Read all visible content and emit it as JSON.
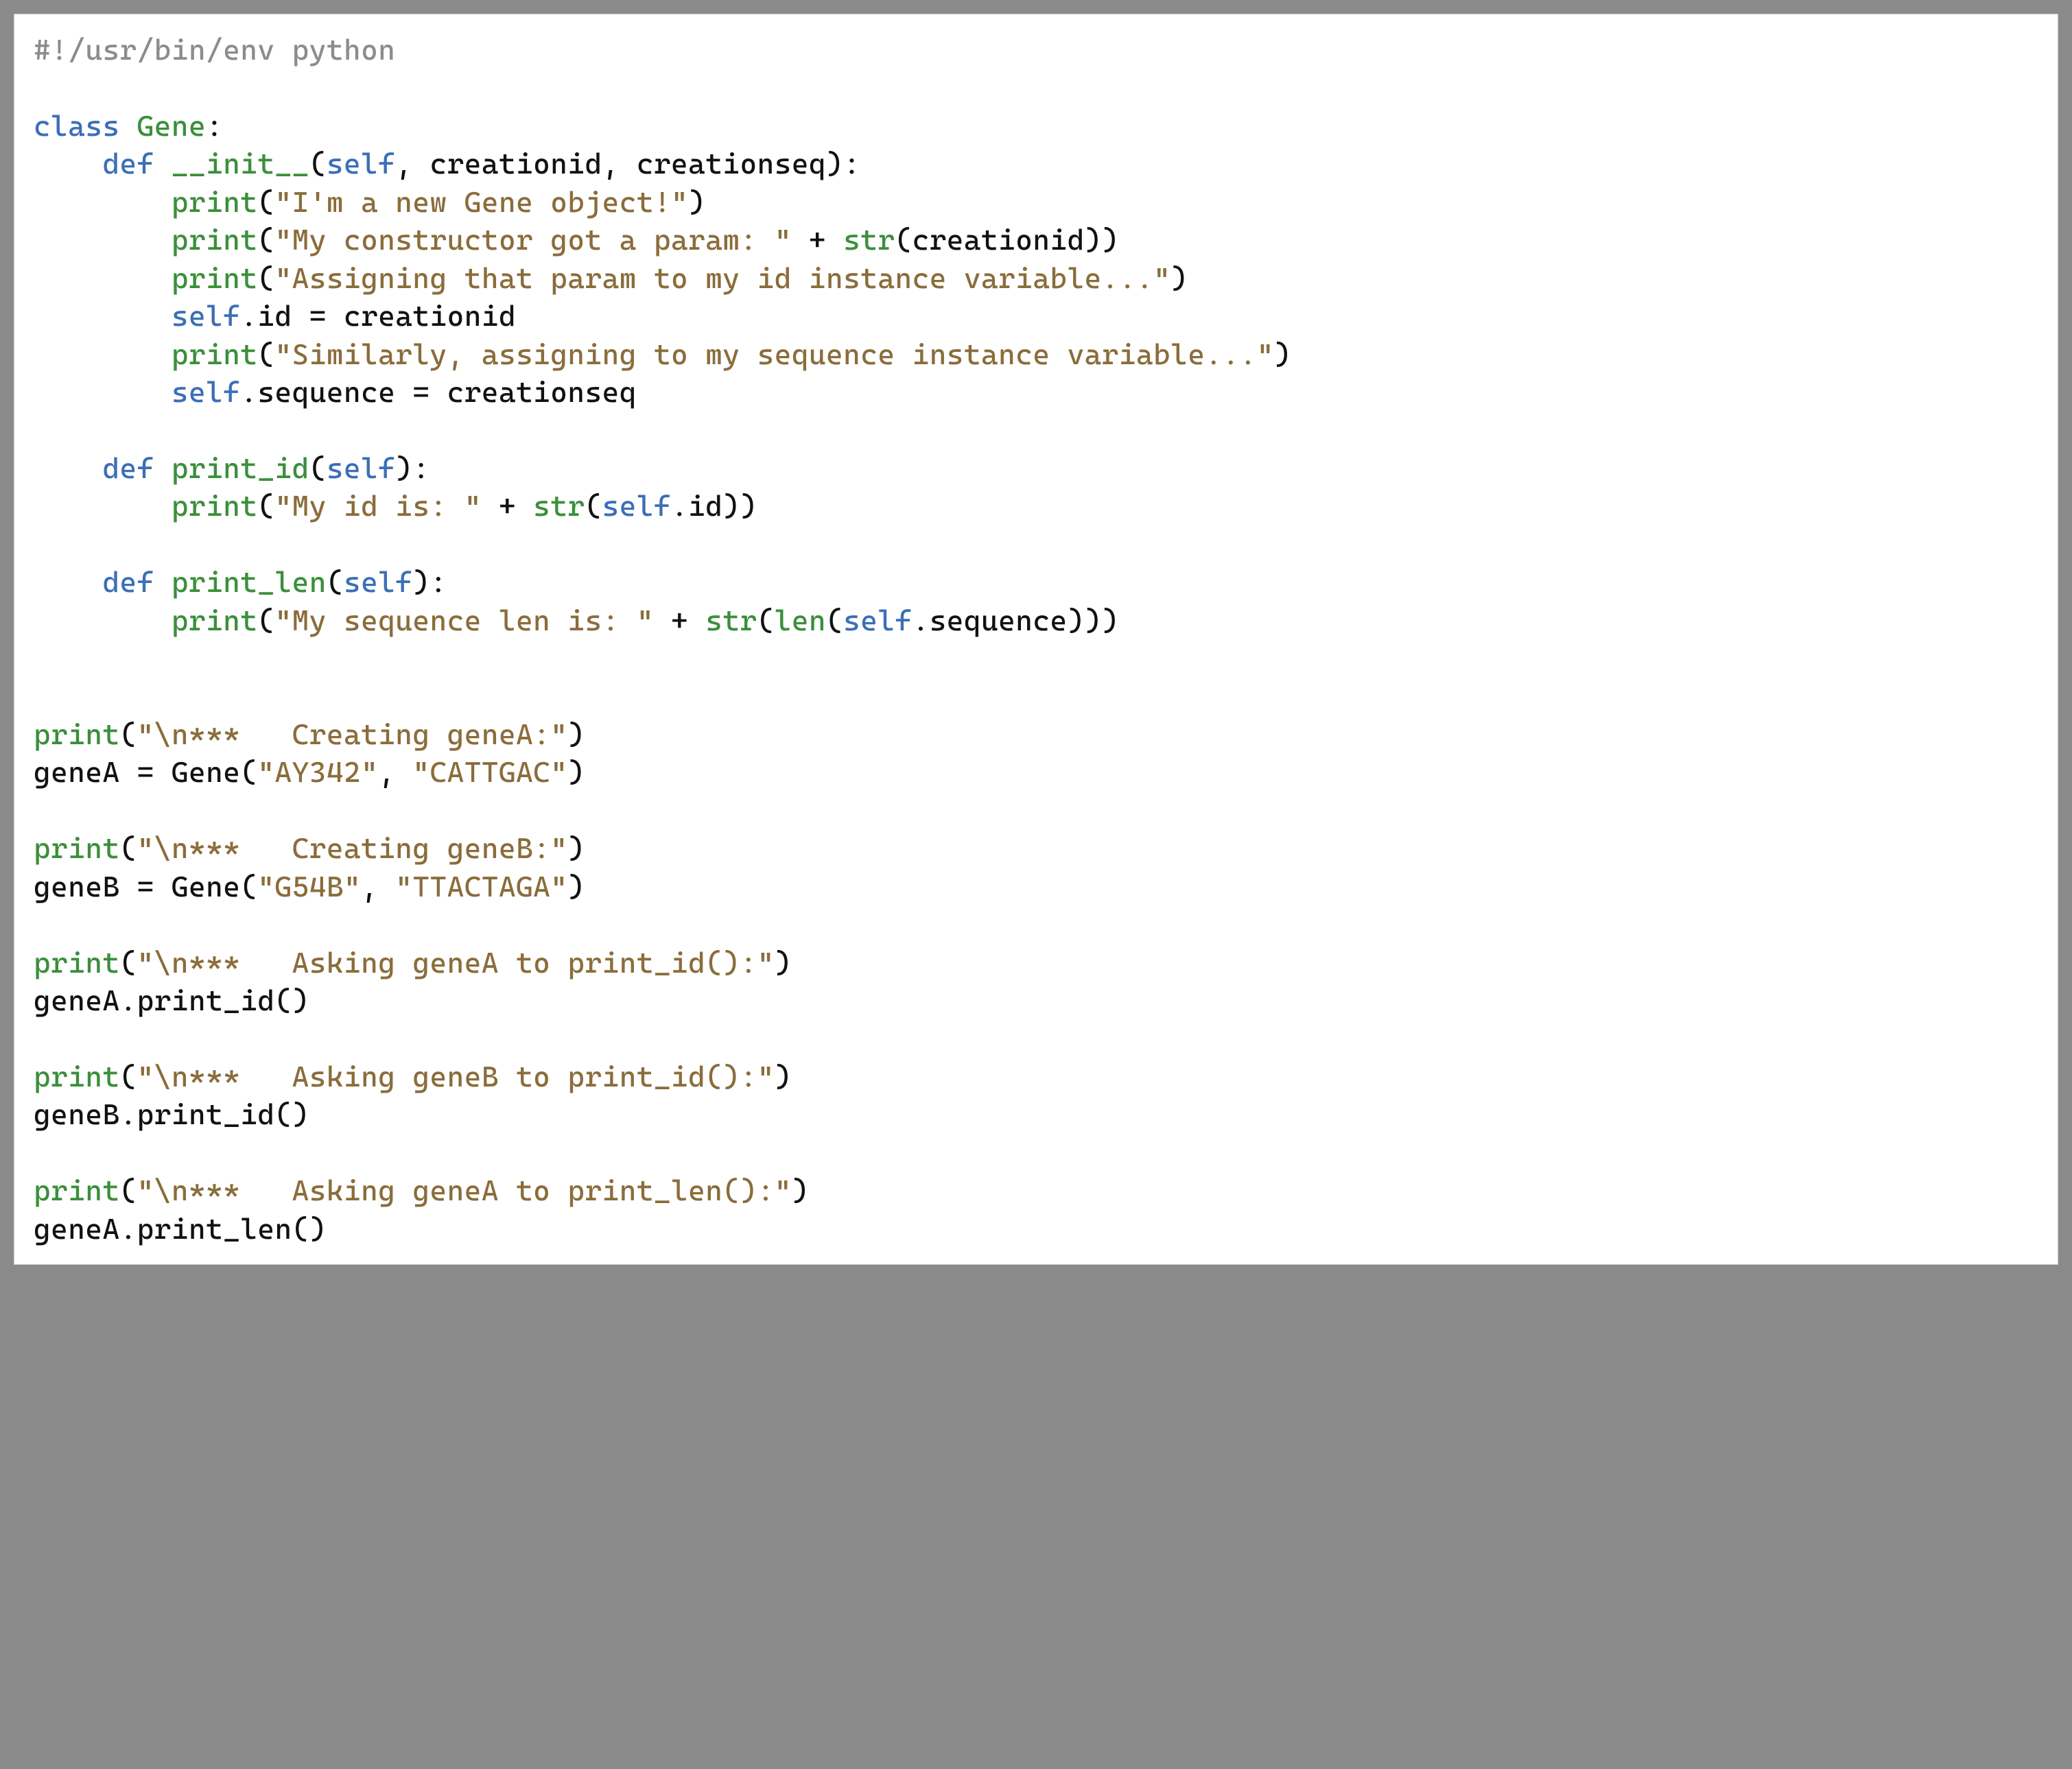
{
  "code": {
    "lines": [
      [
        {
          "cls": "c-comment",
          "text": "#!/usr/bin/env python"
        }
      ],
      [],
      [
        {
          "cls": "c-keyword",
          "text": "class"
        },
        {
          "cls": "c-plain",
          "text": " "
        },
        {
          "cls": "c-classname",
          "text": "Gene"
        },
        {
          "cls": "c-plain",
          "text": ":"
        }
      ],
      [
        {
          "cls": "c-plain",
          "text": "    "
        },
        {
          "cls": "c-keyword",
          "text": "def"
        },
        {
          "cls": "c-plain",
          "text": " "
        },
        {
          "cls": "c-defname",
          "text": "__init__"
        },
        {
          "cls": "c-plain",
          "text": "("
        },
        {
          "cls": "c-keyword",
          "text": "self"
        },
        {
          "cls": "c-plain",
          "text": ", creationid, creationseq):"
        }
      ],
      [
        {
          "cls": "c-plain",
          "text": "        "
        },
        {
          "cls": "c-builtin",
          "text": "print"
        },
        {
          "cls": "c-plain",
          "text": "("
        },
        {
          "cls": "c-string",
          "text": "\"I'm a new Gene object!\""
        },
        {
          "cls": "c-plain",
          "text": ")"
        }
      ],
      [
        {
          "cls": "c-plain",
          "text": "        "
        },
        {
          "cls": "c-builtin",
          "text": "print"
        },
        {
          "cls": "c-plain",
          "text": "("
        },
        {
          "cls": "c-string",
          "text": "\"My constructor got a param: \""
        },
        {
          "cls": "c-plain",
          "text": " + "
        },
        {
          "cls": "c-builtin",
          "text": "str"
        },
        {
          "cls": "c-plain",
          "text": "(creationid))"
        }
      ],
      [
        {
          "cls": "c-plain",
          "text": "        "
        },
        {
          "cls": "c-builtin",
          "text": "print"
        },
        {
          "cls": "c-plain",
          "text": "("
        },
        {
          "cls": "c-string",
          "text": "\"Assigning that param to my id instance variable...\""
        },
        {
          "cls": "c-plain",
          "text": ")"
        }
      ],
      [
        {
          "cls": "c-plain",
          "text": "        "
        },
        {
          "cls": "c-keyword",
          "text": "self"
        },
        {
          "cls": "c-plain",
          "text": ".id = creationid"
        }
      ],
      [
        {
          "cls": "c-plain",
          "text": "        "
        },
        {
          "cls": "c-builtin",
          "text": "print"
        },
        {
          "cls": "c-plain",
          "text": "("
        },
        {
          "cls": "c-string",
          "text": "\"Similarly, assigning to my sequence instance variable...\""
        },
        {
          "cls": "c-plain",
          "text": ")"
        }
      ],
      [
        {
          "cls": "c-plain",
          "text": "        "
        },
        {
          "cls": "c-keyword",
          "text": "self"
        },
        {
          "cls": "c-plain",
          "text": ".sequence = creationseq"
        }
      ],
      [],
      [
        {
          "cls": "c-plain",
          "text": "    "
        },
        {
          "cls": "c-keyword",
          "text": "def"
        },
        {
          "cls": "c-plain",
          "text": " "
        },
        {
          "cls": "c-defname",
          "text": "print_id"
        },
        {
          "cls": "c-plain",
          "text": "("
        },
        {
          "cls": "c-keyword",
          "text": "self"
        },
        {
          "cls": "c-plain",
          "text": "):"
        }
      ],
      [
        {
          "cls": "c-plain",
          "text": "        "
        },
        {
          "cls": "c-builtin",
          "text": "print"
        },
        {
          "cls": "c-plain",
          "text": "("
        },
        {
          "cls": "c-string",
          "text": "\"My id is: \""
        },
        {
          "cls": "c-plain",
          "text": " + "
        },
        {
          "cls": "c-builtin",
          "text": "str"
        },
        {
          "cls": "c-plain",
          "text": "("
        },
        {
          "cls": "c-keyword",
          "text": "self"
        },
        {
          "cls": "c-plain",
          "text": ".id))"
        }
      ],
      [],
      [
        {
          "cls": "c-plain",
          "text": "    "
        },
        {
          "cls": "c-keyword",
          "text": "def"
        },
        {
          "cls": "c-plain",
          "text": " "
        },
        {
          "cls": "c-defname",
          "text": "print_len"
        },
        {
          "cls": "c-plain",
          "text": "("
        },
        {
          "cls": "c-keyword",
          "text": "self"
        },
        {
          "cls": "c-plain",
          "text": "):"
        }
      ],
      [
        {
          "cls": "c-plain",
          "text": "        "
        },
        {
          "cls": "c-builtin",
          "text": "print"
        },
        {
          "cls": "c-plain",
          "text": "("
        },
        {
          "cls": "c-string",
          "text": "\"My sequence len is: \""
        },
        {
          "cls": "c-plain",
          "text": " + "
        },
        {
          "cls": "c-builtin",
          "text": "str"
        },
        {
          "cls": "c-plain",
          "text": "("
        },
        {
          "cls": "c-builtin",
          "text": "len"
        },
        {
          "cls": "c-plain",
          "text": "("
        },
        {
          "cls": "c-keyword",
          "text": "self"
        },
        {
          "cls": "c-plain",
          "text": ".sequence)))"
        }
      ],
      [],
      [],
      [
        {
          "cls": "c-builtin",
          "text": "print"
        },
        {
          "cls": "c-plain",
          "text": "("
        },
        {
          "cls": "c-string",
          "text": "\"\\n***   Creating geneA:\""
        },
        {
          "cls": "c-plain",
          "text": ")"
        }
      ],
      [
        {
          "cls": "c-plain",
          "text": "geneA = Gene("
        },
        {
          "cls": "c-string",
          "text": "\"AY342\""
        },
        {
          "cls": "c-plain",
          "text": ", "
        },
        {
          "cls": "c-string",
          "text": "\"CATTGAC\""
        },
        {
          "cls": "c-plain",
          "text": ")"
        }
      ],
      [],
      [
        {
          "cls": "c-builtin",
          "text": "print"
        },
        {
          "cls": "c-plain",
          "text": "("
        },
        {
          "cls": "c-string",
          "text": "\"\\n***   Creating geneB:\""
        },
        {
          "cls": "c-plain",
          "text": ")"
        }
      ],
      [
        {
          "cls": "c-plain",
          "text": "geneB = Gene("
        },
        {
          "cls": "c-string",
          "text": "\"G54B\""
        },
        {
          "cls": "c-plain",
          "text": ", "
        },
        {
          "cls": "c-string",
          "text": "\"TTACTAGA\""
        },
        {
          "cls": "c-plain",
          "text": ")"
        }
      ],
      [],
      [
        {
          "cls": "c-builtin",
          "text": "print"
        },
        {
          "cls": "c-plain",
          "text": "("
        },
        {
          "cls": "c-string",
          "text": "\"\\n***   Asking geneA to print_id():\""
        },
        {
          "cls": "c-plain",
          "text": ")"
        }
      ],
      [
        {
          "cls": "c-plain",
          "text": "geneA.print_id()"
        }
      ],
      [],
      [
        {
          "cls": "c-builtin",
          "text": "print"
        },
        {
          "cls": "c-plain",
          "text": "("
        },
        {
          "cls": "c-string",
          "text": "\"\\n***   Asking geneB to print_id():\""
        },
        {
          "cls": "c-plain",
          "text": ")"
        }
      ],
      [
        {
          "cls": "c-plain",
          "text": "geneB.print_id()"
        }
      ],
      [],
      [
        {
          "cls": "c-builtin",
          "text": "print"
        },
        {
          "cls": "c-plain",
          "text": "("
        },
        {
          "cls": "c-string",
          "text": "\"\\n***   Asking geneA to print_len():\""
        },
        {
          "cls": "c-plain",
          "text": ")"
        }
      ],
      [
        {
          "cls": "c-plain",
          "text": "geneA.print_len()"
        }
      ]
    ]
  }
}
